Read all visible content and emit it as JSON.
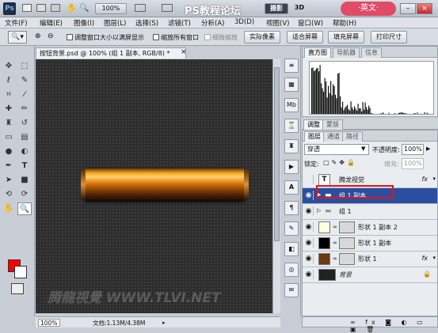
{
  "titlebar": {
    "logo": "Ps",
    "zoom": "100%",
    "workspace": "摄影",
    "btn_3d": "3D",
    "overlay_text": "PS教程论坛",
    "badge": "·英文·",
    "minimize": "–",
    "maximize": "□",
    "close": "×"
  },
  "menu": [
    "文件(F)",
    "编辑(E)",
    "图像(I)",
    "图层(L)",
    "选择(S)",
    "滤镜(T)",
    "分析(A)",
    "3D(D)",
    "视图(V)",
    "窗口(W)",
    "帮助(H)"
  ],
  "options": {
    "resize_windows": "调整窗口大小以满屏显示",
    "zoom_all": "缩放所有窗口",
    "scrubby_zoom": "细微缩放",
    "btn_actual": "实际像素",
    "btn_fit": "适合屏幕",
    "btn_fill": "填充屏幕",
    "btn_print": "打印尺寸"
  },
  "document": {
    "tab_title": "按钮背景.psd @ 100% (组 1 副本, RGB/8) *",
    "close": "×",
    "watermark_bottom": "腾龍視覺 WWW.TLVI.NET"
  },
  "status": {
    "zoom": "100%",
    "doc_info": "文档:1.13M/4.38M"
  },
  "colors": {
    "foreground": "#ff0000",
    "background": "#ffffff",
    "selected_layer": "#2a4fa0",
    "highlight_box": "#e01515"
  },
  "panels": {
    "hist_tabs": [
      "直方图",
      "导航器",
      "信息"
    ],
    "adj_tabs": [
      "调整",
      "蒙版"
    ],
    "layer_tabs": [
      "图层",
      "通道",
      "路径"
    ]
  },
  "layers": {
    "blend_mode": "穿透",
    "opacity_label": "不透明度:",
    "opacity": "100%",
    "lock_label": "锁定:",
    "fill_label": "填充:",
    "fill": "100%",
    "items": [
      {
        "name": "腾龙视觉",
        "kind": "text"
      },
      {
        "name": "组 1 副本",
        "kind": "group",
        "selected": true
      },
      {
        "name": "组 1",
        "kind": "group"
      },
      {
        "name": "形状 1 副本 2",
        "kind": "shape",
        "color": "#fffde0"
      },
      {
        "name": "形状 1 副本",
        "kind": "shape",
        "color": "#000000"
      },
      {
        "name": "形状 1",
        "kind": "shape",
        "color": "#6b3a12",
        "fx": "fx"
      },
      {
        "name": "背景",
        "kind": "background"
      }
    ]
  },
  "icons": {
    "toolbox": [
      "move-icon",
      "marquee-icon",
      "lasso-icon",
      "quick-select-icon",
      "crop-icon",
      "eyedropper-icon",
      "healing-icon",
      "brush-icon",
      "clone-stamp-icon",
      "history-brush-icon",
      "eraser-icon",
      "gradient-icon",
      "blur-icon",
      "dodge-icon",
      "pen-icon",
      "type-icon",
      "path-select-icon",
      "shape-icon",
      "3d-rotate-icon",
      "3d-camera-icon",
      "hand-icon",
      "zoom-icon"
    ],
    "layer_footer": [
      "link-icon",
      "fx-icon",
      "mask-icon",
      "adjustment-icon",
      "group-icon",
      "new-layer-icon",
      "trash-icon"
    ]
  }
}
